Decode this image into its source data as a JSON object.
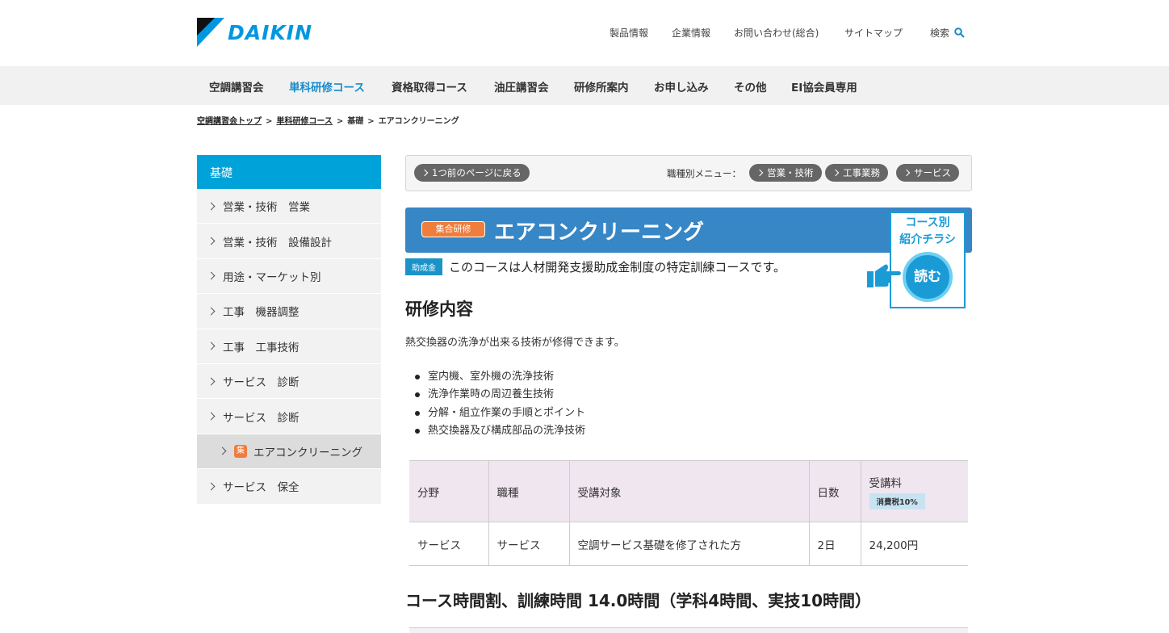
{
  "header": {
    "logo_text": "DAIKIN",
    "util_links": [
      "製品情報",
      "企業情報",
      "お問い合わせ(総合)",
      "サイトマップ",
      "検索"
    ]
  },
  "gnav": [
    "空調講習会",
    "単科研修コース",
    "資格取得コース",
    "油圧講習会",
    "研修所案内",
    "お申し込み",
    "その他",
    "EI協会員専用"
  ],
  "breadcrumb": [
    "空調講習会トップ",
    "単科研修コース",
    "基礎",
    "エアコンクリーニング"
  ],
  "sidebar": {
    "heading": "基礎",
    "items": [
      "営業・技術　営業",
      "営業・技術　設備設計",
      "用途・マーケット別",
      "工事　機器調整",
      "工事　工事技術",
      "サービス　診断",
      "サービス　診断",
      "エアコンクリーニング",
      "サービス　保全"
    ],
    "active_badge": "集"
  },
  "back_bar": {
    "back_label": "1つ前のページに戻る",
    "menu_label": "職種別メニュー：",
    "menu_items": [
      "営業・技術",
      "工事業務",
      "サービス"
    ]
  },
  "course": {
    "category_badge": "集合研修",
    "title": "エアコンクリーニング",
    "subsidy_badge": "助成金",
    "subsidy_text": "このコースは人材開発支援助成金制度の特定訓練コースです。",
    "flyer_title_1": "コース別",
    "flyer_title_2": "紹介チラシ",
    "flyer_button": "読む"
  },
  "content": {
    "section_title": "研修内容",
    "description": "熱交換器の洗浄が出来る技術が修得できます。",
    "bullets": [
      "室内機、室外機の洗浄技術",
      "洗浄作業時の周辺養生技術",
      "分解・組立作業の手順とポイント",
      "熱交換器及び構成部品の洗浄技術"
    ],
    "table": {
      "headers": [
        "分野",
        "職種",
        "受講対象",
        "日数",
        "受講料"
      ],
      "tax_badge": "消費税10%",
      "row": [
        "サービス",
        "サービス",
        "空調サービス基礎を修了された方",
        "2日",
        "24,200円"
      ]
    },
    "hours_title": "コース時間割、訓練時間 14.0時間（学科4時間、実技10時間）"
  },
  "colors": {
    "accent": "#00a3d9",
    "title_bar": "#3786c6",
    "orange": "#ef7d3c"
  }
}
